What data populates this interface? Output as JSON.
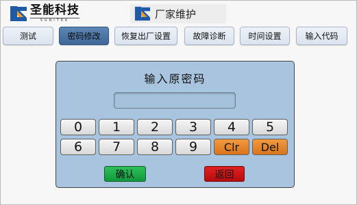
{
  "header": {
    "logo_text": "圣能科技",
    "logo_subtext": "SUNITEK",
    "title": "厂家维护",
    "brand_colors": {
      "blue": "#1f5aa6",
      "orange": "#f39a1f"
    }
  },
  "tabs": [
    {
      "label": "测试",
      "active": false
    },
    {
      "label": "密码修改",
      "active": true
    },
    {
      "label": "恢复出厂设置",
      "active": false
    },
    {
      "label": "故障诊断",
      "active": false
    },
    {
      "label": "时间设置",
      "active": false
    },
    {
      "label": "输入代码",
      "active": false
    }
  ],
  "keypad": {
    "title": "输入原密码",
    "password_value": "",
    "row1": [
      "0",
      "1",
      "2",
      "3",
      "4",
      "5"
    ],
    "row2": [
      "6",
      "7",
      "8",
      "9"
    ],
    "clear_label": "Clr",
    "delete_label": "Del",
    "confirm_label": "确认",
    "back_label": "返回"
  },
  "colors": {
    "panel": "#a9c4de",
    "active_tab": "#4a72a3",
    "confirm": "#1fae4b",
    "back": "#c81414",
    "function_key": "#e6852c"
  }
}
